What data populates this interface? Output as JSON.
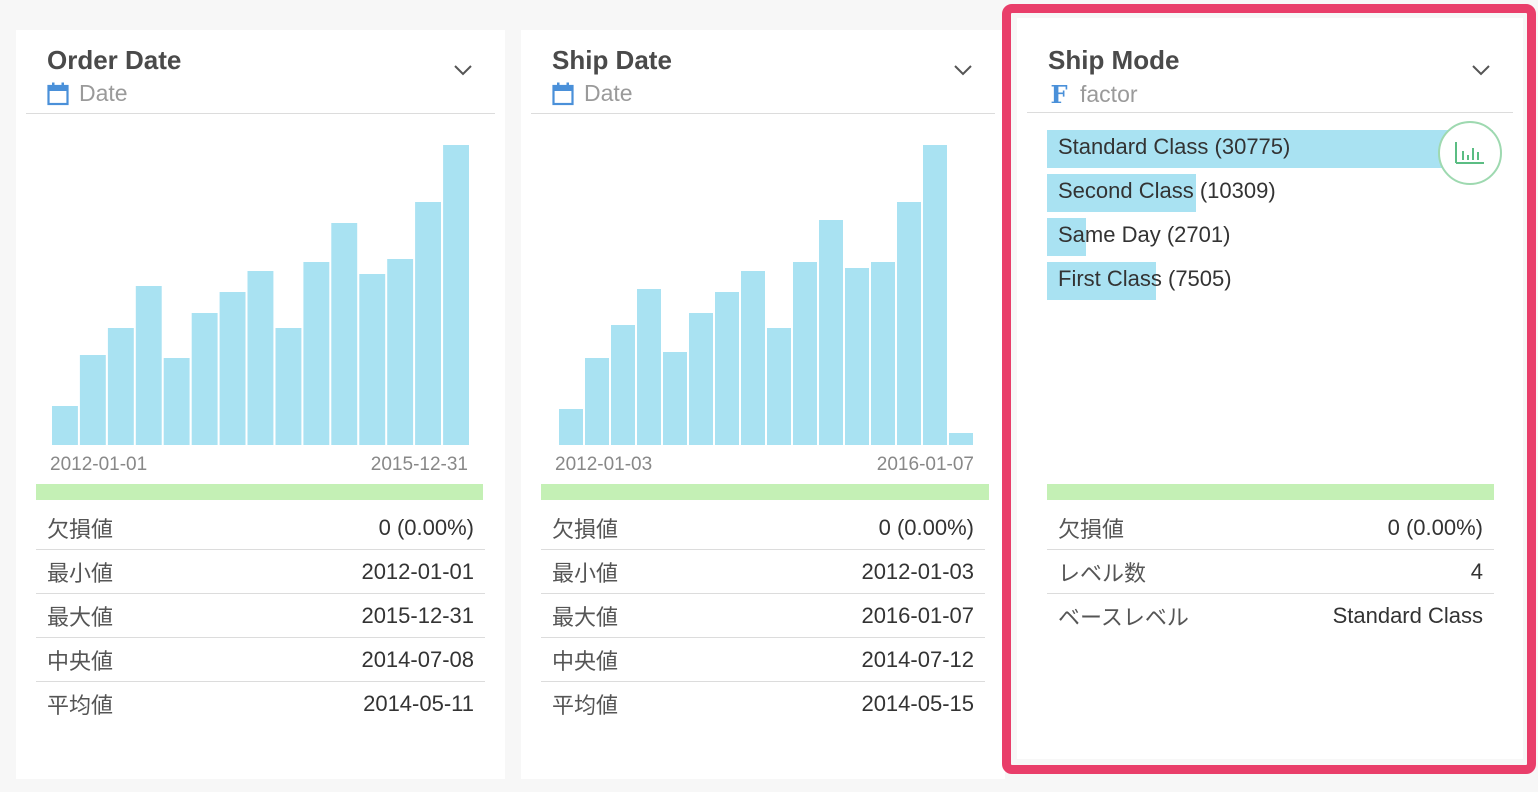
{
  "cards": [
    {
      "title": "Order Date",
      "type_label": "Date",
      "type_icon": "calendar-icon",
      "axis_min": "2012-01-01",
      "axis_max": "2015-12-31",
      "stats": [
        {
          "label": "欠損値",
          "value": "0 (0.00%)"
        },
        {
          "label": "最小値",
          "value": "2012-01-01"
        },
        {
          "label": "最大値",
          "value": "2015-12-31"
        },
        {
          "label": "中央値",
          "value": "2014-07-08"
        },
        {
          "label": "平均値",
          "value": "2014-05-11"
        }
      ]
    },
    {
      "title": "Ship Date",
      "type_label": "Date",
      "type_icon": "calendar-icon",
      "axis_min": "2012-01-03",
      "axis_max": "2016-01-07",
      "stats": [
        {
          "label": "欠損値",
          "value": "0 (0.00%)"
        },
        {
          "label": "最小値",
          "value": "2012-01-03"
        },
        {
          "label": "最大値",
          "value": "2016-01-07"
        },
        {
          "label": "中央値",
          "value": "2014-07-12"
        },
        {
          "label": "平均値",
          "value": "2014-05-15"
        }
      ]
    },
    {
      "title": "Ship Mode",
      "type_label": "factor",
      "type_icon": "factor-icon",
      "type_icon_glyph": "F",
      "factors": [
        {
          "label": "Standard Class (30775)",
          "count": 30775
        },
        {
          "label": "Second Class (10309)",
          "count": 10309
        },
        {
          "label": "Same Day (2701)",
          "count": 2701
        },
        {
          "label": "First Class (7505)",
          "count": 7505
        }
      ],
      "stats": [
        {
          "label": "欠損値",
          "value": "0 (0.00%)"
        },
        {
          "label": "レベル数",
          "value": "4"
        },
        {
          "label": "ベースレベル",
          "value": "Standard Class"
        }
      ]
    }
  ],
  "colors": {
    "bar": "#a9e2f2",
    "quality_bar": "#c4f0b5",
    "highlight": "#e93e6a",
    "icon_blue": "#4a90d9"
  },
  "chart_data": [
    {
      "type": "bar",
      "title": "Order Date",
      "x_range": [
        "2012-01-01",
        "2015-12-31"
      ],
      "values": [
        13,
        30,
        39,
        53,
        29,
        44,
        51,
        58,
        39,
        61,
        74,
        57,
        62,
        81,
        100
      ]
    },
    {
      "type": "bar",
      "title": "Ship Date",
      "x_range": [
        "2012-01-03",
        "2016-01-07"
      ],
      "values": [
        12,
        29,
        40,
        52,
        31,
        44,
        51,
        58,
        39,
        61,
        75,
        59,
        61,
        81,
        100,
        4
      ]
    },
    {
      "type": "bar",
      "title": "Ship Mode",
      "categories": [
        "Standard Class",
        "Second Class",
        "Same Day",
        "First Class"
      ],
      "values": [
        30775,
        10309,
        2701,
        7505
      ]
    }
  ]
}
